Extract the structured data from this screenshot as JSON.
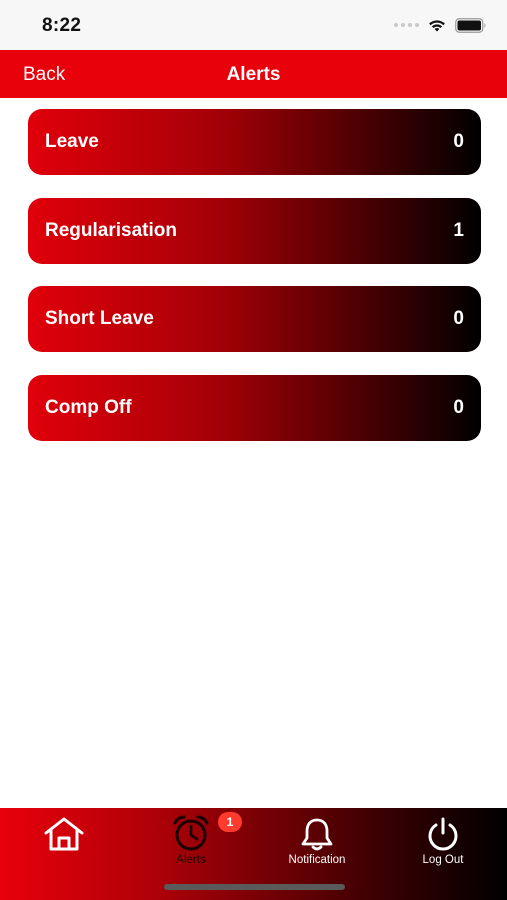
{
  "status_bar": {
    "time": "8:22"
  },
  "nav": {
    "back_label": "Back",
    "title": "Alerts"
  },
  "alerts": [
    {
      "label": "Leave",
      "count": "0"
    },
    {
      "label": "Regularisation",
      "count": "1"
    },
    {
      "label": "Short Leave",
      "count": "0"
    },
    {
      "label": "Comp Off",
      "count": "0"
    }
  ],
  "tab_bar": {
    "tabs": [
      {
        "label": "",
        "icon": "home-icon"
      },
      {
        "label": "Alerts",
        "icon": "alarm-clock-icon",
        "badge": "1",
        "active": true
      },
      {
        "label": "Notification",
        "icon": "bell-icon"
      },
      {
        "label": "Log Out",
        "icon": "power-icon"
      }
    ]
  },
  "colors": {
    "brand_red": "#e8000b",
    "badge_red": "#ff3b30"
  }
}
